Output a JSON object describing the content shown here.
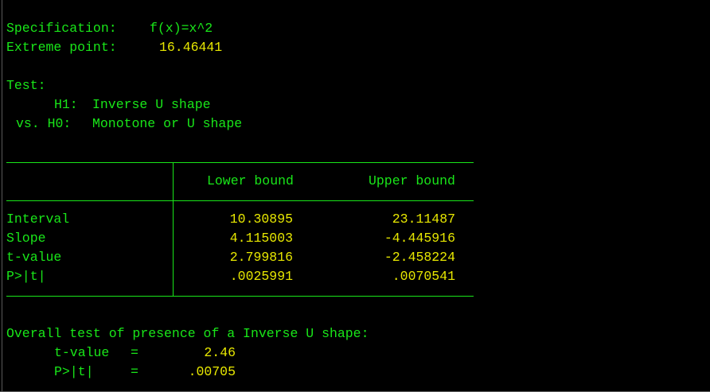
{
  "spec": {
    "label": "Specification:",
    "value": "f(x)=x^2"
  },
  "extreme": {
    "label": "Extreme point:",
    "value": "16.46441"
  },
  "test": {
    "label": "Test:",
    "h1_prefix": "H1:",
    "h1_text": "Inverse U shape",
    "h0_prefix": "vs. H0:",
    "h0_text": "Monotone or U shape"
  },
  "table": {
    "headers": [
      "Lower bound",
      "Upper bound"
    ],
    "rows": [
      {
        "label": "Interval",
        "lower": "10.30895",
        "upper": "23.11487"
      },
      {
        "label": "Slope",
        "lower": "4.115003",
        "upper": "-4.445916"
      },
      {
        "label": "t-value",
        "lower": "2.799816",
        "upper": "-2.458224"
      },
      {
        "label": "P>|t|",
        "lower": ".0025991",
        "upper": ".0070541"
      }
    ]
  },
  "overall": {
    "title": "Overall test of presence of a Inverse U shape:",
    "tvalue_label": "t-value",
    "tvalue_eq": "=",
    "tvalue": "2.46",
    "p_label": "P>|t|",
    "p_eq": "=",
    "p_value": ".00705"
  },
  "colors": {
    "text_green": "#19e619",
    "value_yellow": "#e8e800",
    "background": "#000000"
  }
}
